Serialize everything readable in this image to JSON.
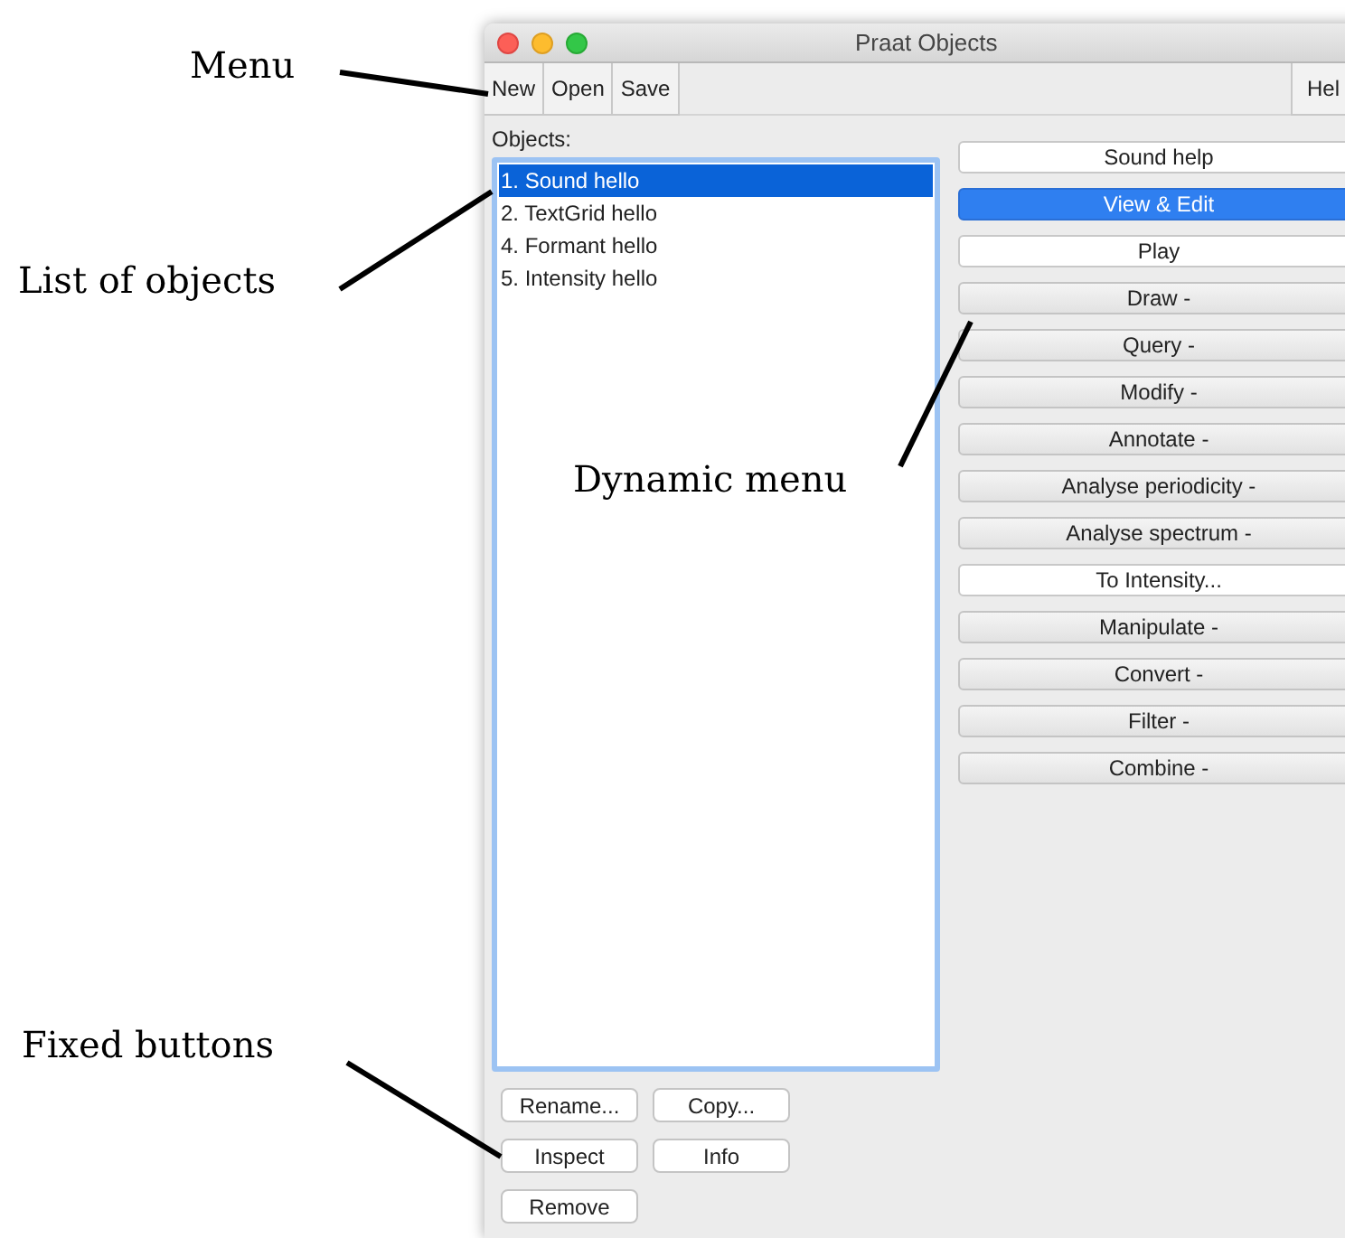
{
  "annotations": [
    {
      "label": "Menu"
    },
    {
      "label": "List of objects"
    },
    {
      "label": "Dynamic menu"
    },
    {
      "label": "Fixed buttons"
    }
  ],
  "window": {
    "title": "Praat Objects"
  },
  "menu": [
    {
      "label": "New"
    },
    {
      "label": "Open"
    },
    {
      "label": "Save"
    }
  ],
  "help_menu": {
    "label": "Hel"
  },
  "objects": {
    "label": "Objects:",
    "items": [
      {
        "label": "1. Sound hello",
        "selected": true
      },
      {
        "label": "2. TextGrid hello",
        "selected": false
      },
      {
        "label": "4. Formant hello",
        "selected": false
      },
      {
        "label": "5. Intensity hello",
        "selected": false
      }
    ]
  },
  "dynamic_menu": [
    {
      "label": "Sound help",
      "kind": "command",
      "selected": false
    },
    {
      "label": "View & Edit",
      "kind": "command",
      "selected": true
    },
    {
      "label": "Play",
      "kind": "command",
      "selected": false
    },
    {
      "label": "Draw -",
      "kind": "submenu",
      "selected": false
    },
    {
      "label": "Query -",
      "kind": "submenu",
      "selected": false
    },
    {
      "label": "Modify -",
      "kind": "submenu",
      "selected": false
    },
    {
      "label": "Annotate -",
      "kind": "submenu",
      "selected": false
    },
    {
      "label": "Analyse periodicity -",
      "kind": "submenu",
      "selected": false
    },
    {
      "label": "Analyse spectrum -",
      "kind": "submenu",
      "selected": false
    },
    {
      "label": "To Intensity...",
      "kind": "command",
      "selected": false
    },
    {
      "label": "Manipulate -",
      "kind": "submenu",
      "selected": false
    },
    {
      "label": "Convert -",
      "kind": "submenu",
      "selected": false
    },
    {
      "label": "Filter -",
      "kind": "submenu",
      "selected": false
    },
    {
      "label": "Combine -",
      "kind": "submenu",
      "selected": false
    }
  ],
  "fixed_buttons": [
    {
      "label": "Rename..."
    },
    {
      "label": "Copy..."
    },
    {
      "label": "Inspect"
    },
    {
      "label": "Info"
    },
    {
      "label": "Remove"
    }
  ]
}
